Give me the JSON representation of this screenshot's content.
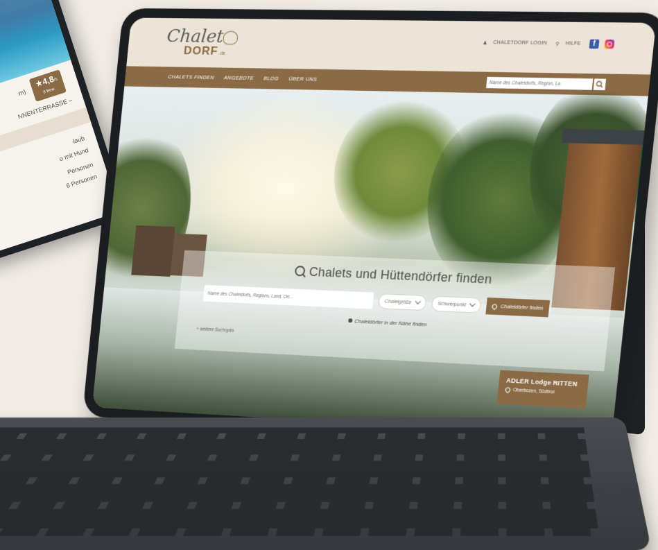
{
  "phone": {
    "rating": "★4,8",
    "rating_scale": "/5",
    "rating_sub": "9 Bew.",
    "rating_prefix": "m)",
    "line_title": "NNENTERRASSE –",
    "lines": [
      "laub",
      "o mit Hund",
      "Personen",
      "6 Personen"
    ]
  },
  "header": {
    "logo_script": "Chalet",
    "logo_dorf": "DORF",
    "logo_suffix": ".de",
    "login_label": "CHALETDORF LOGIN",
    "help_label": "HILFE",
    "facebook_glyph": "f"
  },
  "nav": {
    "items": [
      "CHALETS FINDEN",
      "ANGEBOTE",
      "BLOG",
      "ÜBER UNS"
    ],
    "search_placeholder": "Name des Chaletdorfs, Region, La"
  },
  "hero": {
    "title": "Chalets und Hüttendörfer finden",
    "search_placeholder": "Name des Chaletdorfs, Regions, Land, Ort...",
    "dropdown_size": "Chaletgröße",
    "dropdown_focus": "Schwerpunkt",
    "find_button": "Chaletdörfer finden",
    "nearby_link": "Chaletdörfer in der Nähe finden",
    "more_link": "+ weitere Suchoptio"
  },
  "badge": {
    "name": "ADLER Lodge RITTEN",
    "location": "Oberbozen, Südtirol"
  },
  "colors": {
    "brand_brown": "#8a6b45",
    "header_bg": "#ece4d7",
    "facebook_blue": "#3b5bab"
  },
  "icons": [
    "user-icon",
    "search-icon",
    "facebook-icon",
    "instagram-icon",
    "location-pin-icon",
    "chevron-down-icon"
  ]
}
